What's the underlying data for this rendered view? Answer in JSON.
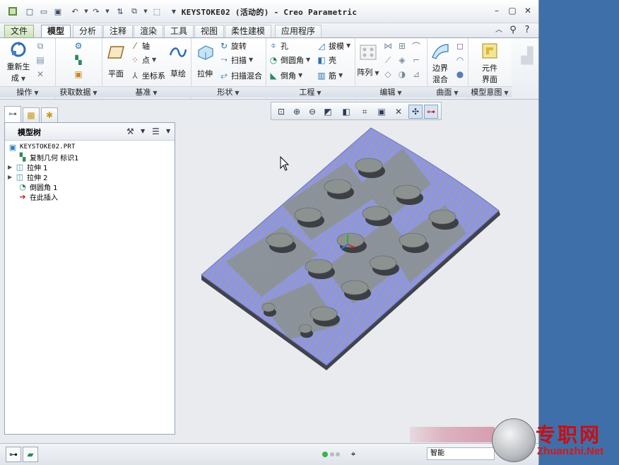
{
  "window": {
    "title": "KEYSTOKE02 (活动的) - Creo Parametric"
  },
  "tabs": [
    "文件",
    "模型",
    "分析",
    "注释",
    "渲染",
    "工具",
    "视图",
    "柔性建模",
    "应用程序"
  ],
  "ribbon": {
    "groups": [
      "操作",
      "获取数据",
      "基准",
      "形状",
      "工程",
      "编辑",
      "曲面",
      "模型意图"
    ],
    "operations": {
      "regen_line1": "重新生",
      "regen_line2": "成"
    },
    "datum": {
      "plane": "平面",
      "axis": "轴",
      "point": "点",
      "csys": "坐标系",
      "sketch": "草绘"
    },
    "shapes": {
      "extrude": "拉伸",
      "revolve": "旋转",
      "sweep": "扫描",
      "swept_blend": "扫描混合"
    },
    "engineering": {
      "hole": "孔",
      "round": "倒圆角",
      "chamfer": "倒角",
      "draft": "拔模",
      "shell": "壳",
      "rib": "筋"
    },
    "editing": {
      "pattern": "阵列"
    },
    "surfaces": {
      "boundary_line1": "边界",
      "boundary_line2": "混合"
    },
    "model_intent": {
      "component_line1": "元件",
      "component_line2": "界面"
    }
  },
  "tree": {
    "title": "模型树",
    "items": [
      {
        "label": "KEYSTOKE02.PRT",
        "icon": "part-icon"
      },
      {
        "label": "复制几何 标识1",
        "icon": "copy-geom-icon"
      },
      {
        "label": "拉伸 1",
        "icon": "extrude-icon"
      },
      {
        "label": "拉伸 2",
        "icon": "extrude-icon"
      },
      {
        "label": "倒圆角 1",
        "icon": "round-icon"
      },
      {
        "label": "在此插入",
        "icon": "insert-arrow-icon"
      }
    ]
  },
  "status": {
    "filter": "智能"
  },
  "watermark": {
    "text": "专职网",
    "url": "Zhuanzhi.Net"
  },
  "colors": {
    "model_blue": "#8a8fe8",
    "model_gray": "#8c9290",
    "accent_green": "#3a8a2a"
  }
}
